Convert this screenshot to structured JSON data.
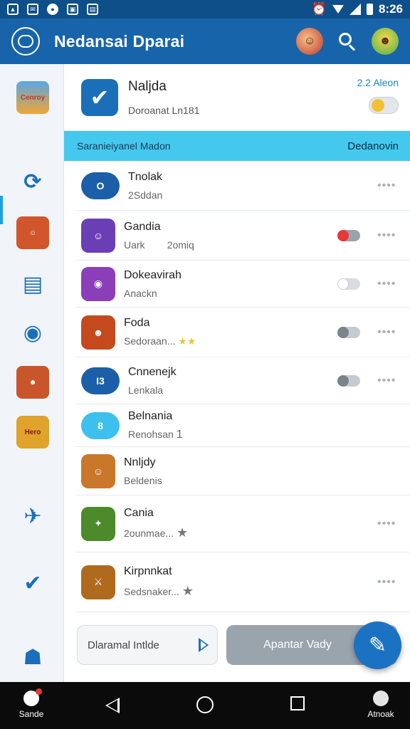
{
  "status_bar": {
    "time": "8:26"
  },
  "app_bar": {
    "title": "Nedansai Dparai"
  },
  "top_card": {
    "title": "Naljda",
    "subtitle": "Doroanat Ln181",
    "link": "2.2 Aleon"
  },
  "banner": {
    "left": "Saranieiyanel Madon",
    "right": "Dedanovin"
  },
  "rows": [
    {
      "title": "Tnolak",
      "sub": "2Sddan",
      "icon_text": "O",
      "icon_color": "#1b5fa8"
    },
    {
      "title": "Gandia",
      "sub": "Uark",
      "sub2": "2omiq",
      "icon_color": "#6a3fb5"
    },
    {
      "title": "Dokeavirah",
      "sub": "Anackn",
      "icon_color": "#8a3fb8"
    },
    {
      "title": "Foda",
      "sub": "Sedoraan...",
      "stars": "★★",
      "icon_color": "#c44a1e"
    },
    {
      "title": "Cnnenejk",
      "sub": "Lenkala",
      "icon_text": "I3",
      "icon_color": "#1b5fa8"
    },
    {
      "title": "Belnania",
      "sub": "Renohsan",
      "extra": "1",
      "icon_text": "8",
      "icon_color": "#3ec0ef"
    },
    {
      "title": "Nnljdy",
      "sub": "Beldenis",
      "icon_color": "#c9772a"
    },
    {
      "title": "Cania",
      "sub": "2ounmae...",
      "star": "★",
      "icon_color": "#4c8a2a"
    },
    {
      "title": "Kirpnnkat",
      "sub": "Sedsnaker...",
      "star": "★",
      "icon_color": "#b06a1e"
    }
  ],
  "bottom": {
    "input_text": "Dlaramal Intlde",
    "button": "Apantar Vady"
  },
  "rail_items": [
    {
      "label": "Cenroy"
    },
    {
      "label": "Hero"
    }
  ],
  "nav": {
    "left_label": "Sande",
    "right_label": "Atnoak"
  }
}
